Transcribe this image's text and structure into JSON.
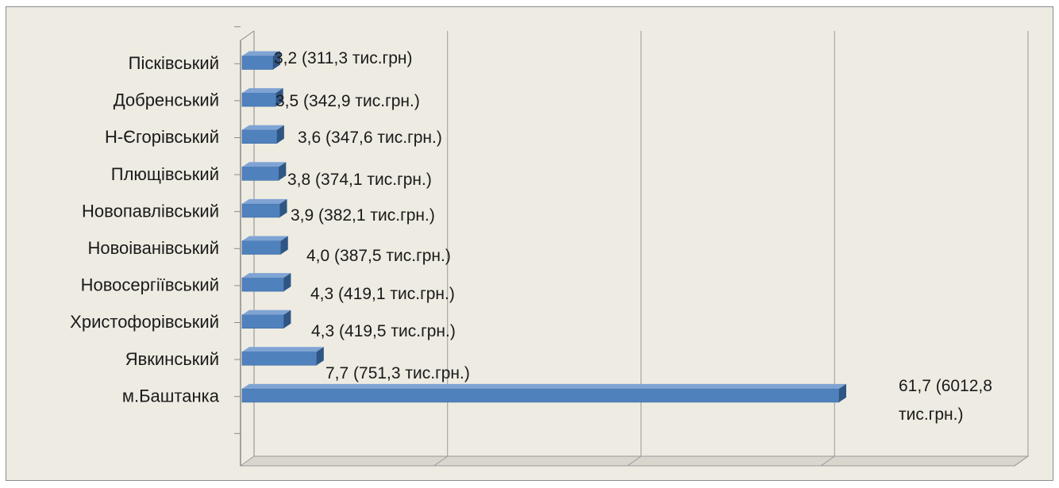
{
  "chart_data": {
    "type": "bar",
    "orientation": "horizontal",
    "categories": [
      "Пісківський",
      "Добренський",
      "Н-Єгорівський",
      "Плющівський",
      "Новопавлівський",
      "Новоіванівський",
      "Новосергіївський",
      "Христофорівський",
      "Явкинський",
      "м.Баштанка"
    ],
    "values": [
      3.2,
      3.5,
      3.6,
      3.8,
      3.9,
      4.0,
      4.3,
      4.3,
      7.7,
      61.7
    ],
    "data_labels": [
      [
        "3,2 (311,3 тис.грн)"
      ],
      [
        "3,5 (342,9 тис.грн.)"
      ],
      [
        "3,6 (347,6 тис.грн.)"
      ],
      [
        "3,8 (374,1 тис.грн.)"
      ],
      [
        "3,9 (382,1 тис.грн.)"
      ],
      [
        "4,0 (387,5 тис.грн.)"
      ],
      [
        "4,3 (419,1 тис.грн.)"
      ],
      [
        "4,3 (419,5 тис.грн.)"
      ],
      [
        "7,7 (751,3 тис.грн.)"
      ],
      [
        "61,7 (6012,8",
        "тис.грн.)"
      ]
    ],
    "xlim": [
      0,
      80
    ],
    "grid": true,
    "title": "",
    "xlabel": "",
    "ylabel": "",
    "colors": {
      "bar": "#4f81bd",
      "bar_top": "#7fa4d4",
      "bar_side": "#2f5683",
      "frame_bg": "#eeebe2",
      "grid": "#9a9a9a"
    }
  }
}
